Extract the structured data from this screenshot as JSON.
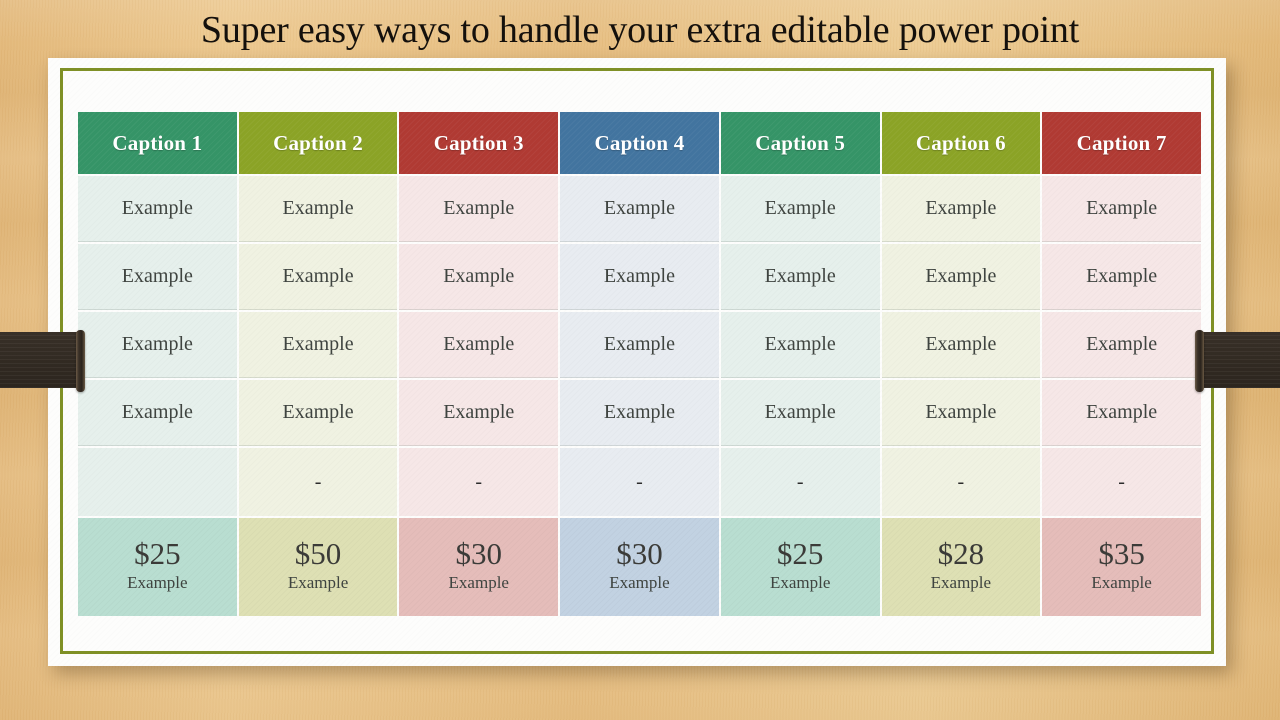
{
  "slide": {
    "title": "Super easy ways to handle your extra editable power point",
    "background_color": "#e7bf82",
    "card_background": "#fdfdfc",
    "card_border_color": "#7f9026",
    "strap_color": "#352d25"
  },
  "table": {
    "columns": [
      {
        "label": "Caption 1",
        "header_color": "#359467",
        "body_color": "#e6f0ec",
        "price_color": "#b9ded1"
      },
      {
        "label": "Caption 2",
        "header_color": "#8ba326",
        "body_color": "#f0f2e2",
        "price_color": "#dee0b4"
      },
      {
        "label": "Caption 3",
        "header_color": "#b03a33",
        "body_color": "#f6e7e7",
        "price_color": "#e5bdba"
      },
      {
        "label": "Caption 4",
        "header_color": "#42749f",
        "body_color": "#e8ecf1",
        "price_color": "#c2d2e2"
      },
      {
        "label": "Caption 5",
        "header_color": "#359467",
        "body_color": "#e6f0ec",
        "price_color": "#b9ded1"
      },
      {
        "label": "Caption 6",
        "header_color": "#8ba326",
        "body_color": "#f0f2e2",
        "price_color": "#dee0b4"
      },
      {
        "label": "Caption 7",
        "header_color": "#b03a33",
        "body_color": "#f6e7e7",
        "price_color": "#e5bdba"
      }
    ],
    "rows": [
      {
        "type": "example",
        "cells": [
          "Example",
          "Example",
          "Example",
          "Example",
          "Example",
          "Example",
          "Example"
        ]
      },
      {
        "type": "example",
        "cells": [
          "Example",
          "Example",
          "Example",
          "Example",
          "Example",
          "Example",
          "Example"
        ]
      },
      {
        "type": "example",
        "cells": [
          "Example",
          "Example",
          "Example",
          "Example",
          "Example",
          "Example",
          "Example"
        ]
      },
      {
        "type": "example",
        "cells": [
          "Example",
          "Example",
          "Example",
          "Example",
          "Example",
          "Example",
          "Example"
        ]
      },
      {
        "type": "dash",
        "cells": [
          "",
          "-",
          "-",
          "-",
          "-",
          "-",
          "-"
        ]
      }
    ],
    "price_row": {
      "amounts": [
        "$25",
        "$50",
        "$30",
        "$30",
        "$25",
        "$28",
        "$35"
      ],
      "subtitles": [
        "Example",
        "Example",
        "Example",
        "Example",
        "Example",
        "Example",
        "Example"
      ]
    }
  }
}
